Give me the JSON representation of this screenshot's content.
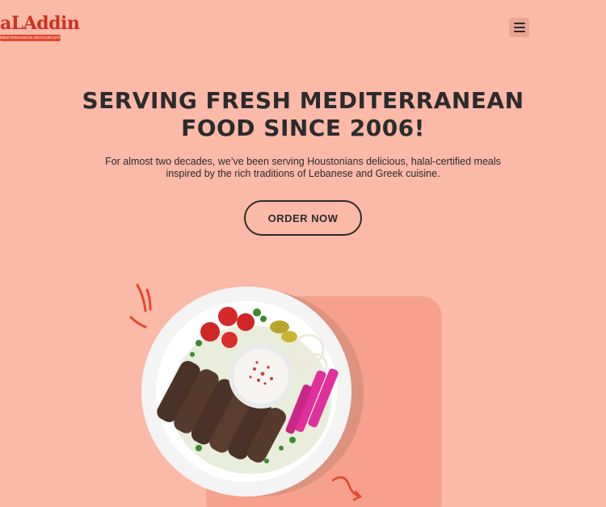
{
  "header": {
    "logo_text": "aLAddin",
    "logo_tagline": "MEDITERRANEAN RESTAURANTS"
  },
  "hero": {
    "title": "SERVING FRESH MEDITERRANEAN FOOD SINCE 2006!",
    "subtitle": "For almost two decades, we’ve been serving Houstonians delicious, halal-certified meals inspired by the rich traditions of Lebanese and Greek cuisine.",
    "cta_label": "ORDER NOW"
  },
  "icons": {
    "menu": "hamburger-menu-icon",
    "decor_top": "red-stroke-doodle-icon",
    "decor_bottom": "red-arrow-doodle-icon"
  },
  "colors": {
    "background": "#fbb9a7",
    "card": "#f6a08d",
    "text": "#2b2b2b",
    "brand_red": "#e5462d"
  }
}
